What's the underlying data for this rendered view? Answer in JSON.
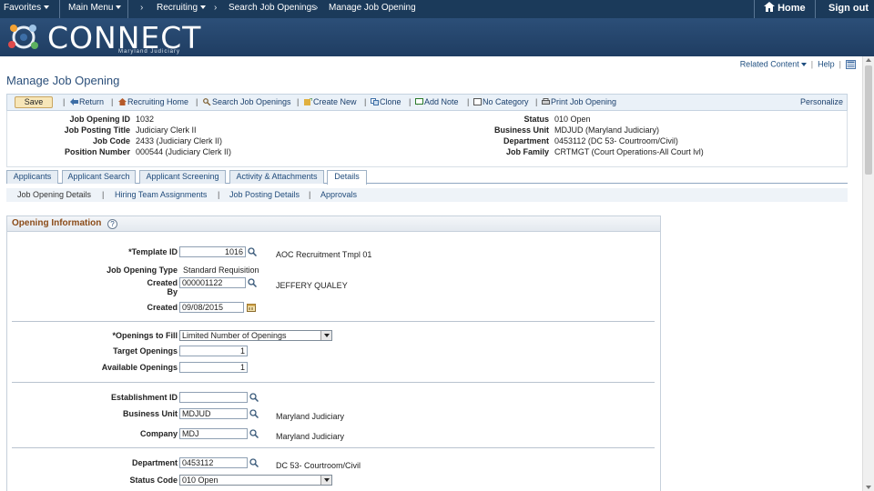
{
  "topnav": {
    "favorites": "Favorites",
    "main_menu": "Main Menu",
    "breadcrumb": [
      "Recruiting",
      "Search Job Openings",
      "Manage Job Opening"
    ],
    "home": "Home",
    "sign_out": "Sign out"
  },
  "banner": {
    "logo_text": "CONNECT",
    "logo_sub": "Maryland Judiciary"
  },
  "util": {
    "related": "Related Content",
    "help": "Help"
  },
  "page_title": "Manage Job Opening",
  "toolbar": {
    "save": "Save",
    "return": "Return",
    "recruiting_home": "Recruiting Home",
    "search_job_openings": "Search Job Openings",
    "create_new": "Create New",
    "clone": "Clone",
    "add_note": "Add Note",
    "no_category": "No Category",
    "print_job_opening": "Print Job Opening",
    "personalize": "Personalize"
  },
  "header": {
    "left": [
      {
        "label": "Job Opening ID",
        "value": "1032"
      },
      {
        "label": "Job Posting Title",
        "value": "Judiciary Clerk II"
      },
      {
        "label": "Job Code",
        "value": "2433 (Judiciary Clerk II)"
      },
      {
        "label": "Position Number",
        "value": "000544 (Judiciary Clerk II)"
      }
    ],
    "right": [
      {
        "label": "Status",
        "value": "010 Open"
      },
      {
        "label": "Business Unit",
        "value": "MDJUD (Maryland Judiciary)"
      },
      {
        "label": "Department",
        "value": "0453112 (DC 53- Courtroom/Civil)"
      },
      {
        "label": "Job Family",
        "value": "CRTMGT (Court Operations-All Court lvl)"
      }
    ]
  },
  "tabs": [
    "Applicants",
    "Applicant Search",
    "Applicant Screening",
    "Activity & Attachments",
    "Details"
  ],
  "subtabs": [
    "Job Opening Details",
    "Hiring Team Assignments",
    "Job Posting Details",
    "Approvals"
  ],
  "section": {
    "title": "Opening Information",
    "help": "?",
    "template_id_label": "*Template ID",
    "template_id": "1016",
    "template_desc": "AOC Recruitment Tmpl 01",
    "job_opening_type_label": "Job Opening Type",
    "job_opening_type": "Standard Requisition",
    "created_by_label_1": "Created",
    "created_by_label_2": "By",
    "created_by": "000001122",
    "created_by_name": "JEFFERY QUALEY",
    "created_label": "Created",
    "created": "09/08/2015",
    "openings_to_fill_label": "*Openings to Fill",
    "openings_to_fill": "Limited Number of Openings",
    "target_openings_label": "Target Openings",
    "target_openings": "1",
    "available_openings_label": "Available Openings",
    "available_openings": "1",
    "establishment_id_label": "Establishment ID",
    "establishment_id": "",
    "business_unit_label": "Business Unit",
    "business_unit": "MDJUD",
    "business_unit_desc": "Maryland Judiciary",
    "company_label": "Company",
    "company": "MDJ",
    "company_desc": "Maryland Judiciary",
    "department_label": "Department",
    "department": "0453112",
    "department_desc": "DC 53- Courtroom/Civil",
    "status_code_label": "Status Code",
    "status_code": "010 Open"
  }
}
